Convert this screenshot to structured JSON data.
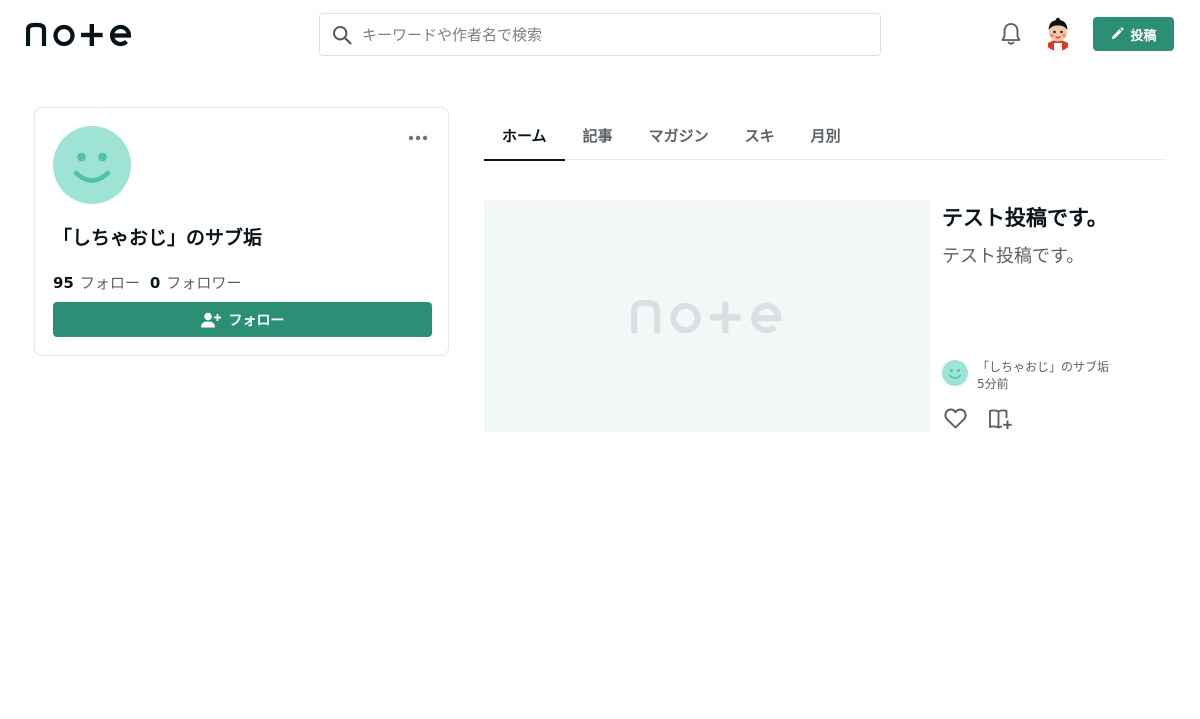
{
  "header": {
    "logo_text": "note",
    "search": {
      "placeholder": "キーワードや作者名で検索",
      "value": ""
    },
    "post_label": "投稿"
  },
  "profile": {
    "name": "「しちゃおじ」のサブ垢",
    "follow_count": "95",
    "follow_label": "フォロー",
    "follower_count": "0",
    "follower_label": "フォロワー",
    "follow_button_label": "フォロー",
    "avatar_color": "#9fe3d5"
  },
  "tabs": [
    {
      "label": "ホーム",
      "active": true
    },
    {
      "label": "記事",
      "active": false
    },
    {
      "label": "マガジン",
      "active": false
    },
    {
      "label": "スキ",
      "active": false
    },
    {
      "label": "月別",
      "active": false
    }
  ],
  "article": {
    "title": "テスト投稿です。",
    "excerpt": "テスト投稿です。",
    "author": "「しちゃおじ」のサブ垢",
    "time": "5分前",
    "thumbnail_logo": "note"
  },
  "colors": {
    "accent": "#2a8f74",
    "text": "#08131a",
    "subtext": "#5a6268",
    "avatar": "#9fe3d5"
  },
  "icons": {
    "search": "search-icon",
    "bell": "bell-icon",
    "pen": "pen-icon",
    "more": "more-icon",
    "add_user": "add-user-icon",
    "like": "heart-icon",
    "magazine": "magazine-add-icon"
  }
}
